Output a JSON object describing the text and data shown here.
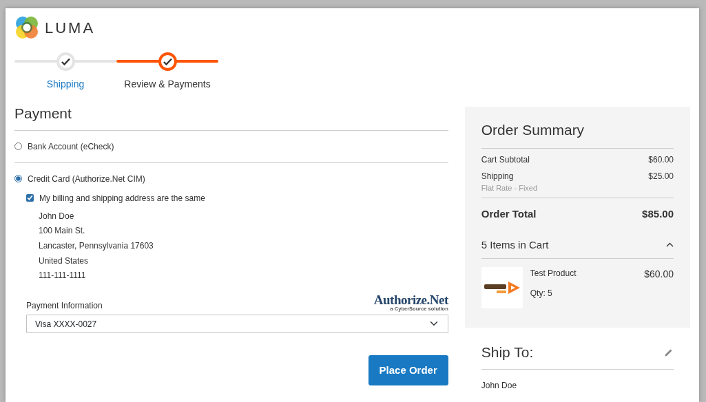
{
  "logo": {
    "text": "LUMA"
  },
  "steps": [
    {
      "label": "Shipping",
      "selected": false,
      "completed": true
    },
    {
      "label": "Review & Payments",
      "selected": true,
      "completed": true
    }
  ],
  "payment": {
    "title": "Payment",
    "methods": [
      {
        "label": "Bank Account (eCheck)",
        "selected": false
      },
      {
        "label": "Credit Card (Authorize.Net CIM)",
        "selected": true
      }
    ],
    "same_address": {
      "label": "My billing and shipping address are the same",
      "checked": true
    },
    "billing_address": [
      "John Doe",
      "100 Main St.",
      "Lancaster, Pennsylvania 17603",
      "United States",
      "111-111-1111"
    ],
    "payment_info_label": "Payment Information",
    "processor_logo": {
      "name": "Authorize.Net",
      "tagline": "a CyberSource solution"
    },
    "card_select": {
      "value": "Visa XXXX-0027"
    },
    "place_order": "Place Order"
  },
  "summary": {
    "title": "Order Summary",
    "rows": [
      {
        "label": "Cart Subtotal",
        "value": "$60.00"
      },
      {
        "label": "Shipping",
        "note": "Flat Rate - Fixed",
        "value": "$25.00"
      }
    ],
    "total": {
      "label": "Order Total",
      "value": "$85.00"
    },
    "items": {
      "title": "5 Items in Cart",
      "expanded": true,
      "list": [
        {
          "name": "Test Product",
          "qty": "Qty: 5",
          "price": "$60.00"
        }
      ]
    }
  },
  "ship_to": {
    "title": "Ship To:",
    "lines": [
      "John Doe"
    ]
  }
}
